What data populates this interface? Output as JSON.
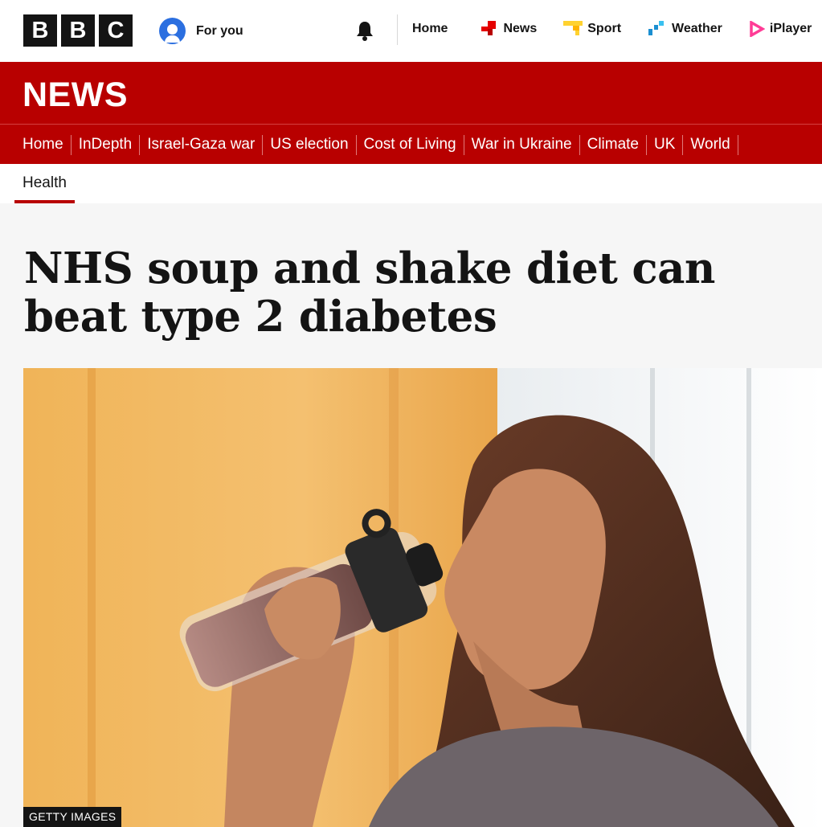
{
  "masthead": {
    "logo_letters": [
      "B",
      "B",
      "C"
    ],
    "for_you_label": "For you",
    "nav": [
      {
        "label": "Home",
        "icon": "none"
      },
      {
        "label": "News",
        "icon": "news-icon",
        "color": "#e50000"
      },
      {
        "label": "Sport",
        "icon": "sport-icon",
        "color": "#ffd230"
      },
      {
        "label": "Weather",
        "icon": "weather-icon",
        "color": "#1b8fd1"
      },
      {
        "label": "iPlayer",
        "icon": "iplayer-icon",
        "color": "#ff3c96"
      }
    ]
  },
  "news_band": {
    "title": "NEWS",
    "color": "#b80000",
    "nav": [
      "Home",
      "InDepth",
      "Israel-Gaza war",
      "US election",
      "Cost of Living",
      "War in Ukraine",
      "Climate",
      "UK",
      "World"
    ]
  },
  "section": {
    "label": "Health"
  },
  "article": {
    "headline": "NHS soup and shake diet can beat type 2 diabetes",
    "image_credit": "GETTY IMAGES"
  }
}
